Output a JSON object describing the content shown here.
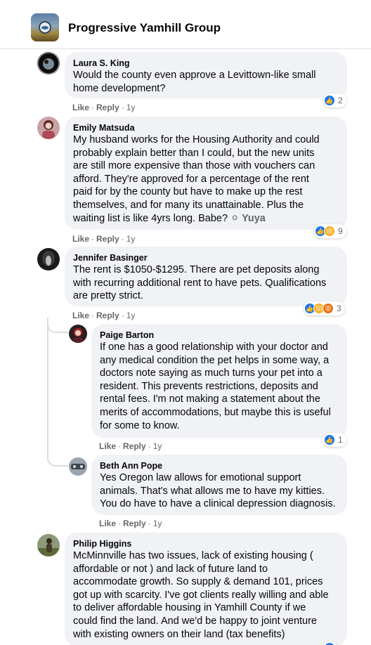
{
  "header": {
    "group_name": "Progressive Yamhill Group"
  },
  "comments": [
    {
      "author": "Laura S. King",
      "text": "Would the county even approve a Levittown-like small\nhome development?",
      "actions": {
        "like": "Like",
        "reply": "Reply",
        "time": "1y"
      },
      "reactions": {
        "icons": [
          "like"
        ],
        "count": "2"
      }
    },
    {
      "author": "Emily Matsuda",
      "text": "My husband works for the Housing Authority and could\nprobably explain better than I could, but the new units\nare still more expensive than those with vouchers can\nafford. They're approved for a percentage of the rent\npaid for by the county but have to make up the rest\nthemselves, and for many its unattainable. Plus the\nwaiting list is like 4yrs long. Babe? ",
      "tagged": "Yuya",
      "actions": {
        "like": "Like",
        "reply": "Reply",
        "time": "1y"
      },
      "reactions": {
        "icons": [
          "like",
          "sad"
        ],
        "count": "9"
      }
    },
    {
      "author": "Jennifer Basinger",
      "text": "The rent is $1050-$1295. There are pet deposits along\nwith recurring additional rent to have pets. Qualifications\nare pretty strict.",
      "actions": {
        "like": "Like",
        "reply": "Reply",
        "time": "1y"
      },
      "reactions": {
        "icons": [
          "like",
          "wow",
          "angry"
        ],
        "count": "3"
      }
    },
    {
      "author": "Paige Barton",
      "text": "If one has a good relationship with your doctor and\nany medical condition the pet helps in some way, a\ndoctors note saying as much turns your pet into a\nresident. This prevents restrictions, deposits and\nrental fees. I'm not making a statement about the\nmerits of accommodations, but maybe this is useful\nfor some to know.",
      "actions": {
        "like": "Like",
        "reply": "Reply",
        "time": "1y"
      },
      "reactions": {
        "icons": [
          "like"
        ],
        "count": "1"
      }
    },
    {
      "author": "Beth Ann Pope",
      "text": "Yes Oregon law allows for emotional support\nanimals. That's what allows me to have my kitties.\nYou do have to have a clinical depression diagnosis.",
      "actions": {
        "like": "Like",
        "reply": "Reply",
        "time": "1y"
      }
    },
    {
      "author": "Philip Higgins",
      "text": "McMinnville has two issues, lack of existing housing (\naffordable or not ) and lack of future land to\naccommodate growth. So supply & demand 101, prices\ngot up with scarcity. I've got clients really willing and able\nto deliver affordable housing in Yamhill County if we\ncould find the land. And we'd be happy to joint venture\nwith existing owners on their land (tax benefits)"
    }
  ],
  "colors": {
    "bubble": "#f0f2f5",
    "like_blue": "#1877f2",
    "meta_gray": "#65676b"
  }
}
